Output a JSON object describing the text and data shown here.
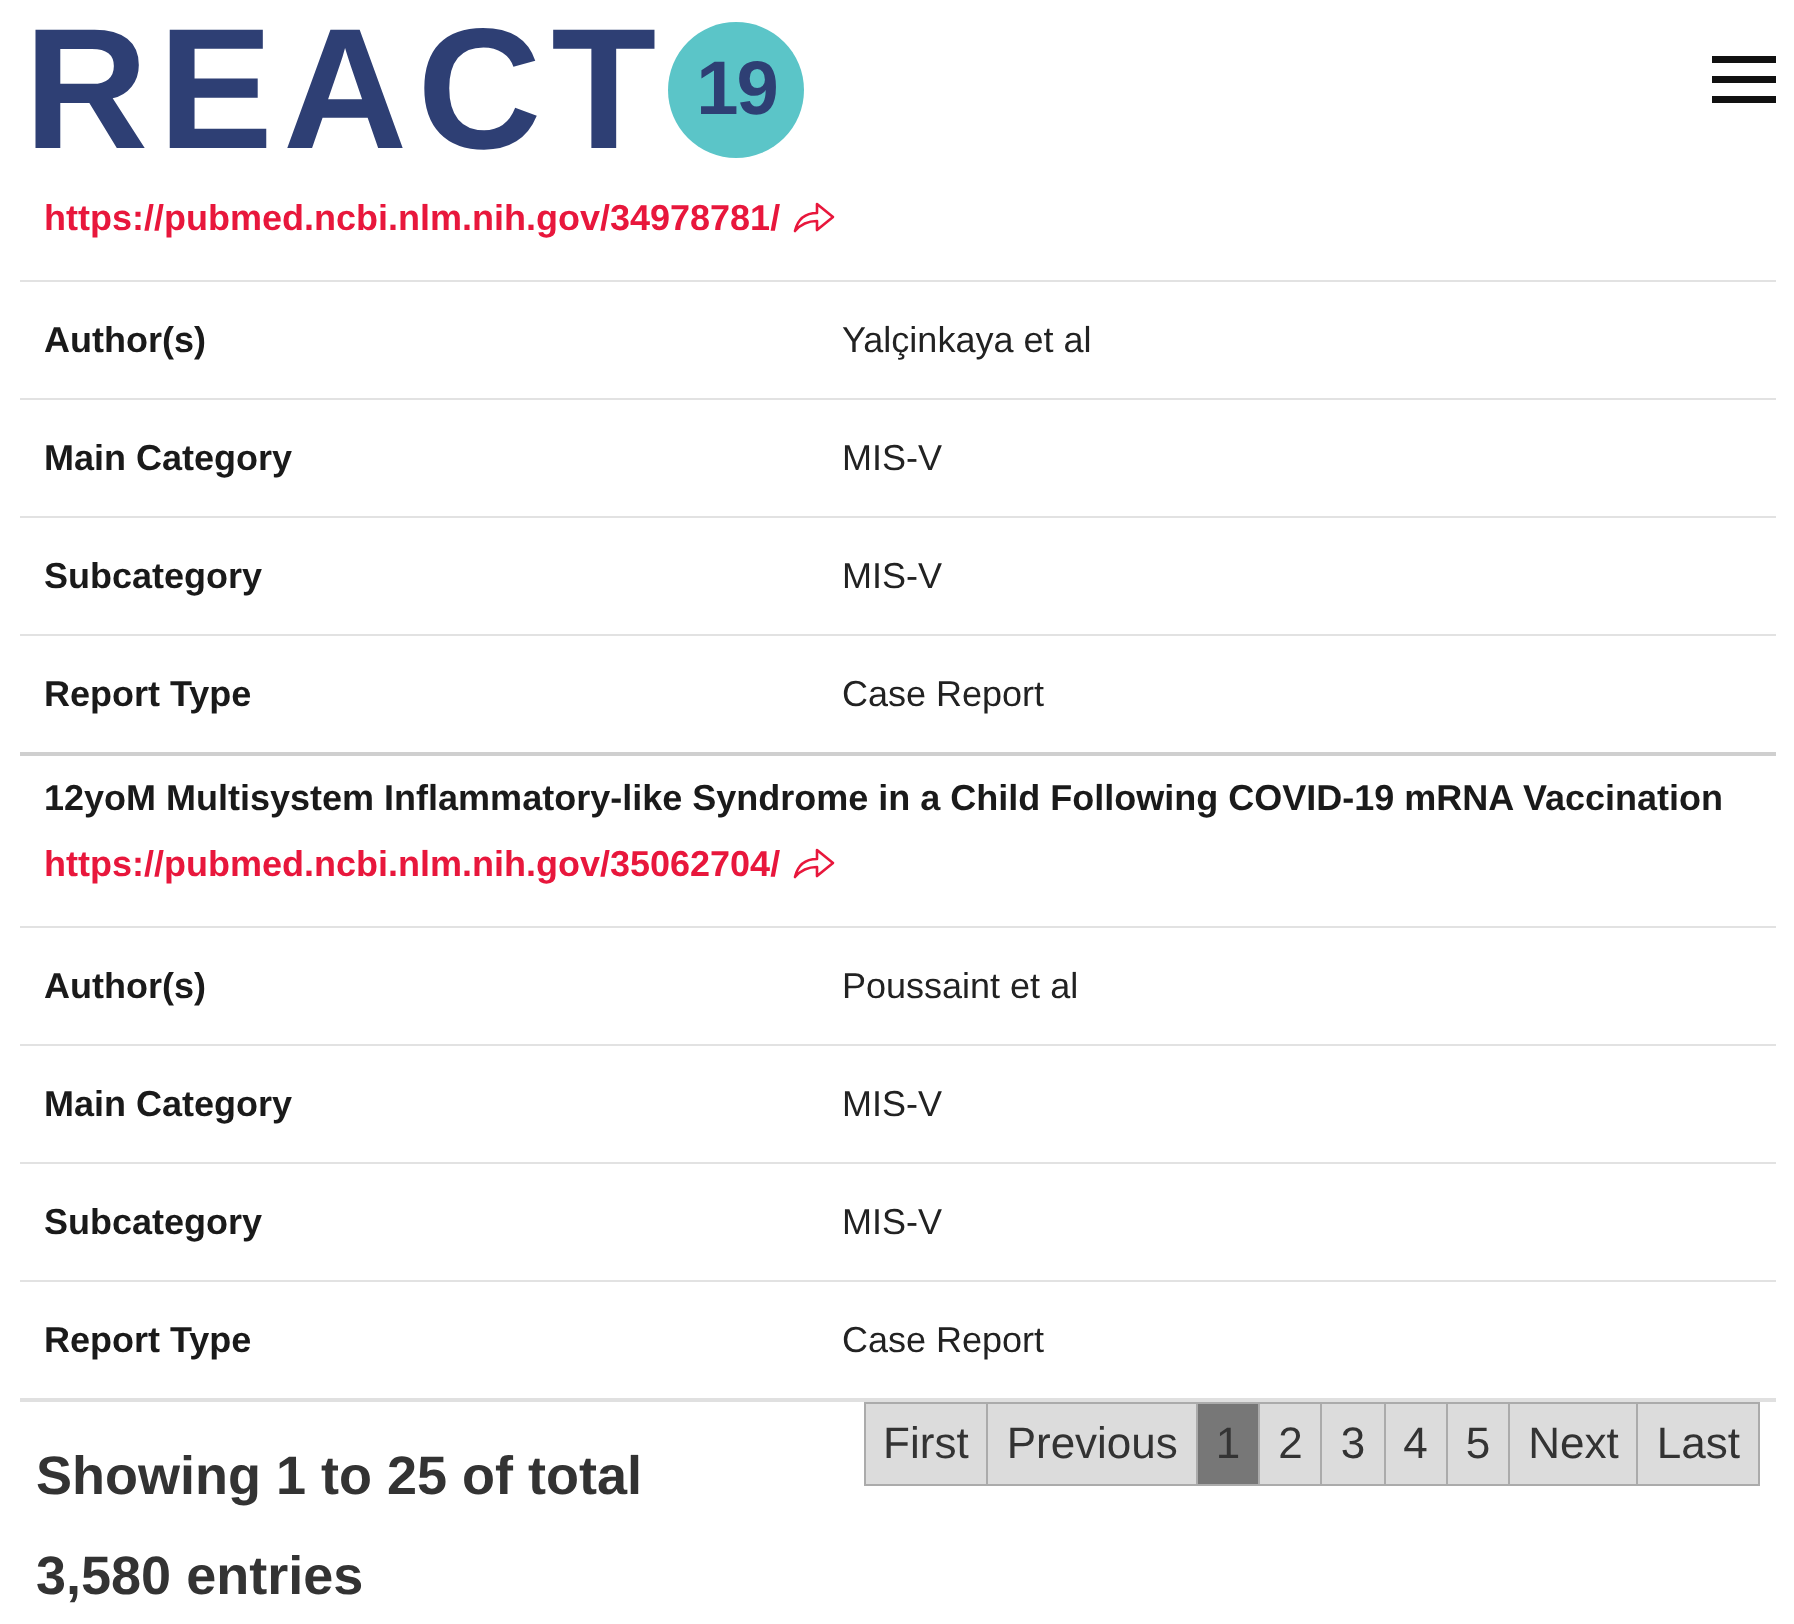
{
  "header": {
    "logo": {
      "word": "REACT",
      "badge": "19"
    }
  },
  "records": [
    {
      "link": "https://pubmed.ncbi.nlm.nih.gov/34978781/",
      "fields": [
        {
          "label": "Author(s)",
          "value": "Yalçinkaya et al"
        },
        {
          "label": "Main Category",
          "value": "MIS-V"
        },
        {
          "label": "Subcategory",
          "value": "MIS-V"
        },
        {
          "label": "Report Type",
          "value": "Case Report"
        }
      ]
    },
    {
      "title": "12yoM Multisystem Inflammatory-like Syndrome in a Child Following COVID-19 mRNA Vaccination",
      "link": "https://pubmed.ncbi.nlm.nih.gov/35062704/",
      "fields": [
        {
          "label": "Author(s)",
          "value": "Poussaint et al"
        },
        {
          "label": "Main Category",
          "value": "MIS-V"
        },
        {
          "label": "Subcategory",
          "value": "MIS-V"
        },
        {
          "label": "Report Type",
          "value": "Case Report"
        }
      ]
    }
  ],
  "footer": {
    "summary": "Showing 1 to 25 of total 3,580 entries",
    "pagination": [
      {
        "label": "First",
        "selected": false
      },
      {
        "label": "Previous",
        "selected": false
      },
      {
        "label": "1",
        "selected": true
      },
      {
        "label": "2",
        "selected": false
      },
      {
        "label": "3",
        "selected": false
      },
      {
        "label": "4",
        "selected": false
      },
      {
        "label": "5",
        "selected": false
      },
      {
        "label": "Next",
        "selected": false
      },
      {
        "label": "Last",
        "selected": false
      }
    ]
  }
}
